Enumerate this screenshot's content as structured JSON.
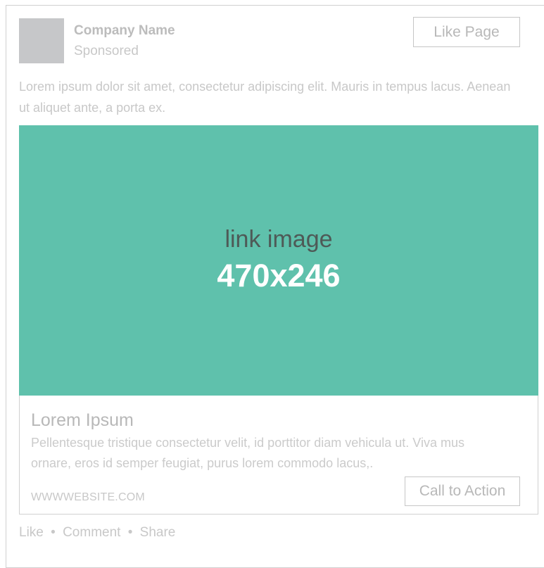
{
  "header": {
    "company_name": "Company Name",
    "sponsored_label": "Sponsored",
    "like_page_label": "Like Page"
  },
  "post": {
    "text": "Lorem ipsum dolor sit amet, consectetur adipiscing elit. Mauris in tempus lacus. Aenean ut aliquet ante, a porta ex."
  },
  "link_preview": {
    "image_label": "link image",
    "image_size": "470x246",
    "image_color": "#5fc1ac",
    "title": "Lorem Ipsum",
    "description": "Pellentesque tristique consectetur velit, id porttitor diam vehicula ut. Viva mus ornare, eros id semper feugiat, purus lorem commodo lacus,.",
    "website": "WWWWEBSITE.COM",
    "cta_label": "Call to Action"
  },
  "actions": {
    "like": "Like",
    "comment": "Comment",
    "share": "Share",
    "separator": "•"
  }
}
